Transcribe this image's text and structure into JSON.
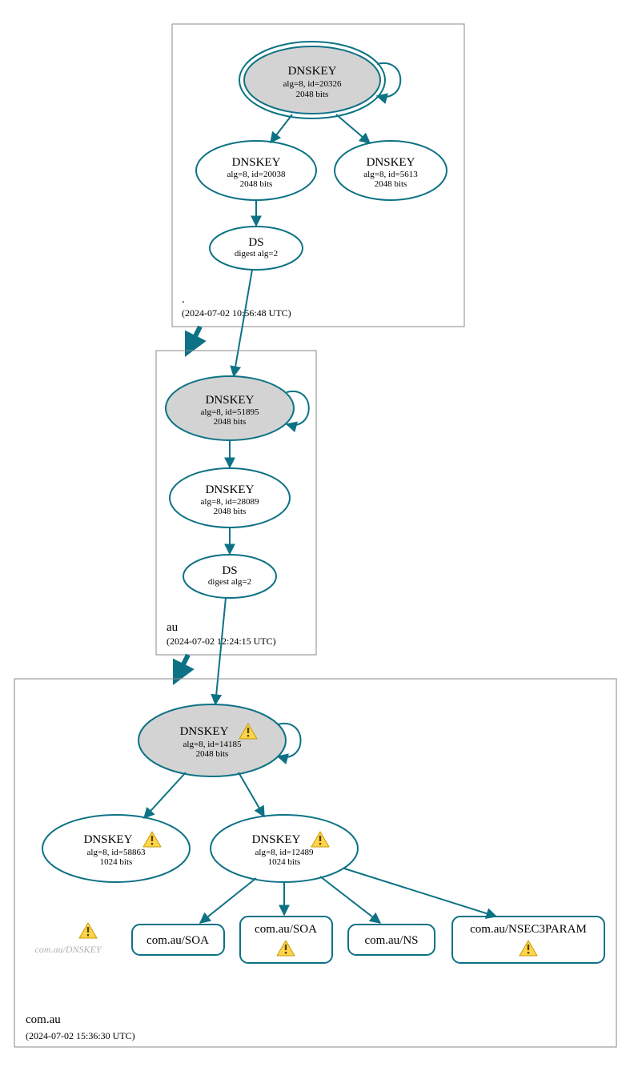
{
  "colors": {
    "stroke": "#0d7285",
    "key_fill": "#d3d3d3",
    "box_stroke": "#888888"
  },
  "zones": [
    {
      "id": "root",
      "label": ".",
      "timestamp": "(2024-07-02 10:56:48 UTC)"
    },
    {
      "id": "au",
      "label": "au",
      "timestamp": "(2024-07-02 12:24:15 UTC)"
    },
    {
      "id": "comau",
      "label": "com.au",
      "timestamp": "(2024-07-02 15:36:30 UTC)"
    }
  ],
  "nodes": {
    "root_ksk": {
      "title": "DNSKEY",
      "line1": "alg=8, id=20326",
      "line2": "2048 bits",
      "warn": false
    },
    "root_zsk1": {
      "title": "DNSKEY",
      "line1": "alg=8, id=20038",
      "line2": "2048 bits",
      "warn": false
    },
    "root_zsk2": {
      "title": "DNSKEY",
      "line1": "alg=8, id=5613",
      "line2": "2048 bits",
      "warn": false
    },
    "root_ds": {
      "title": "DS",
      "line1": "digest alg=2",
      "line2": "",
      "warn": false
    },
    "au_ksk": {
      "title": "DNSKEY",
      "line1": "alg=8, id=51895",
      "line2": "2048 bits",
      "warn": false
    },
    "au_zsk": {
      "title": "DNSKEY",
      "line1": "alg=8, id=28089",
      "line2": "2048 bits",
      "warn": false
    },
    "au_ds": {
      "title": "DS",
      "line1": "digest alg=2",
      "line2": "",
      "warn": false
    },
    "comau_ksk": {
      "title": "DNSKEY",
      "line1": "alg=8, id=14185",
      "line2": "2048 bits",
      "warn": true
    },
    "comau_zsk1": {
      "title": "DNSKEY",
      "line1": "alg=8, id=58863",
      "line2": "1024 bits",
      "warn": true
    },
    "comau_zsk2": {
      "title": "DNSKEY",
      "line1": "alg=8, id=12489",
      "line2": "1024 bits",
      "warn": true
    }
  },
  "rr": {
    "soa1": {
      "label": "com.au/SOA",
      "warn": false
    },
    "soa2": {
      "label": "com.au/SOA",
      "warn": true
    },
    "ns": {
      "label": "com.au/NS",
      "warn": false
    },
    "nsec3": {
      "label": "com.au/NSEC3PARAM",
      "warn": true
    }
  },
  "ghost": {
    "label": "com.au/DNSKEY"
  }
}
